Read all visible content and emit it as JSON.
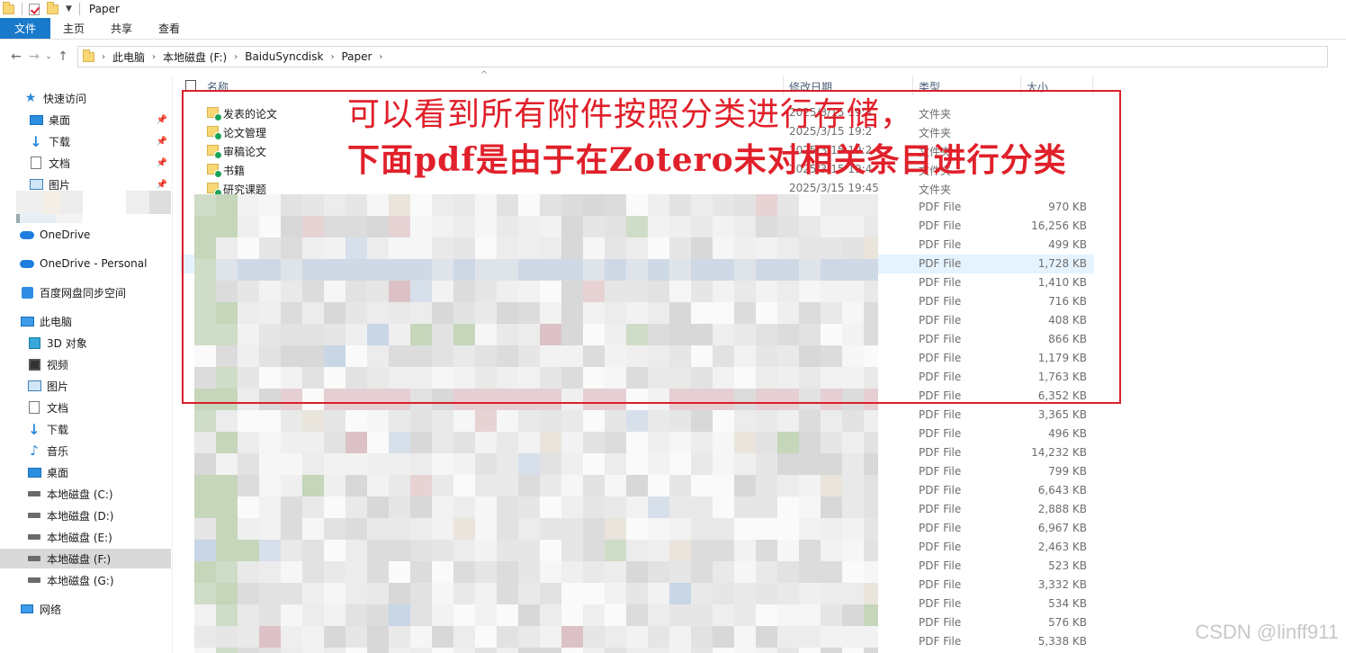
{
  "window": {
    "title": "Paper"
  },
  "ribbon": {
    "tabs": [
      "文件",
      "主页",
      "共享",
      "查看"
    ]
  },
  "address": {
    "crumbs": [
      "此电脑",
      "本地磁盘 (F:)",
      "BaiduSyncdisk",
      "Paper"
    ]
  },
  "sidebar": {
    "items": [
      {
        "label": "快速访问",
        "icon": "star-icon"
      },
      {
        "label": "桌面",
        "icon": "desktop-icon",
        "pinned": true
      },
      {
        "label": "下载",
        "icon": "download-icon",
        "pinned": true
      },
      {
        "label": "文档",
        "icon": "document-icon",
        "pinned": true
      },
      {
        "label": "图片",
        "icon": "picture-icon",
        "pinned": true
      },
      {
        "label": "OneDrive",
        "icon": "cloud-icon"
      },
      {
        "label": "OneDrive - Personal",
        "icon": "cloud-icon"
      },
      {
        "label": "百度网盘同步空间",
        "icon": "baidu-sync-icon"
      },
      {
        "label": "此电脑",
        "icon": "computer-icon"
      },
      {
        "label": "3D 对象",
        "icon": "cube-icon"
      },
      {
        "label": "视频",
        "icon": "video-icon"
      },
      {
        "label": "图片",
        "icon": "picture-icon"
      },
      {
        "label": "文档",
        "icon": "document-icon"
      },
      {
        "label": "下载",
        "icon": "download-icon"
      },
      {
        "label": "音乐",
        "icon": "music-icon"
      },
      {
        "label": "桌面",
        "icon": "desktop-icon"
      },
      {
        "label": "本地磁盘 (C:)",
        "icon": "drive-icon"
      },
      {
        "label": "本地磁盘 (D:)",
        "icon": "drive-icon"
      },
      {
        "label": "本地磁盘 (E:)",
        "icon": "drive-icon"
      },
      {
        "label": "本地磁盘 (F:)",
        "icon": "drive-icon",
        "selected": true
      },
      {
        "label": "本地磁盘 (G:)",
        "icon": "drive-icon"
      },
      {
        "label": "网络",
        "icon": "network-icon"
      }
    ]
  },
  "columns": {
    "name": "名称",
    "date": "修改日期",
    "type": "类型",
    "size": "大小"
  },
  "folders": [
    {
      "name": "发表的论文",
      "date": "2025/3/15 19:4",
      "type": "文件夹"
    },
    {
      "name": "论文管理",
      "date": "2025/3/15 19:2",
      "type": "文件夹"
    },
    {
      "name": "审稿论文",
      "date": "2025/3/15 19:2",
      "type": "文件夹"
    },
    {
      "name": "书籍",
      "date": "2025/3/15 19:4",
      "type": "文件夹"
    },
    {
      "name": "研究课题",
      "date": "2025/3/15 19:45",
      "type": "文件夹"
    }
  ],
  "files": [
    {
      "type": "PDF File",
      "size": "970 KB"
    },
    {
      "type": "PDF File",
      "size": "16,256 KB"
    },
    {
      "type": "PDF File",
      "size": "499 KB"
    },
    {
      "type": "PDF File",
      "size": "1,728 KB",
      "highlight": true
    },
    {
      "type": "PDF File",
      "size": "1,410 KB"
    },
    {
      "type": "PDF File",
      "size": "716 KB"
    },
    {
      "type": "PDF File",
      "size": "408 KB"
    },
    {
      "type": "PDF File",
      "size": "866 KB"
    },
    {
      "type": "PDF File",
      "size": "1,179 KB"
    },
    {
      "type": "PDF File",
      "size": "1,763 KB"
    },
    {
      "type": "PDF File",
      "size": "6,352 KB"
    },
    {
      "type": "PDF File",
      "size": "3,365 KB"
    },
    {
      "type": "PDF File",
      "size": "496 KB"
    },
    {
      "type": "PDF File",
      "size": "14,232 KB"
    },
    {
      "type": "PDF File",
      "size": "799 KB"
    },
    {
      "type": "PDF File",
      "size": "6,643 KB"
    },
    {
      "type": "PDF File",
      "size": "2,888 KB"
    },
    {
      "type": "PDF File",
      "size": "6,967 KB"
    },
    {
      "type": "PDF File",
      "size": "2,463 KB"
    },
    {
      "type": "PDF File",
      "size": "523 KB"
    },
    {
      "type": "PDF File",
      "size": "3,332 KB"
    },
    {
      "type": "PDF File",
      "size": "534 KB"
    },
    {
      "type": "PDF File",
      "size": "576 KB"
    },
    {
      "type": "PDF File",
      "size": "5,338 KB"
    }
  ],
  "annotation": {
    "line1": "可以看到所有附件按照分类进行存储，",
    "line2": "下面pdf是由于在Zotero未对相关条目进行分类",
    "color": "#e0202a"
  },
  "watermark": "CSDN @linff911",
  "colors": {
    "accent": "#1979ca",
    "folder": "#f8d775",
    "selection": "#d9d9d9",
    "highlight": "#e5f3ff"
  }
}
